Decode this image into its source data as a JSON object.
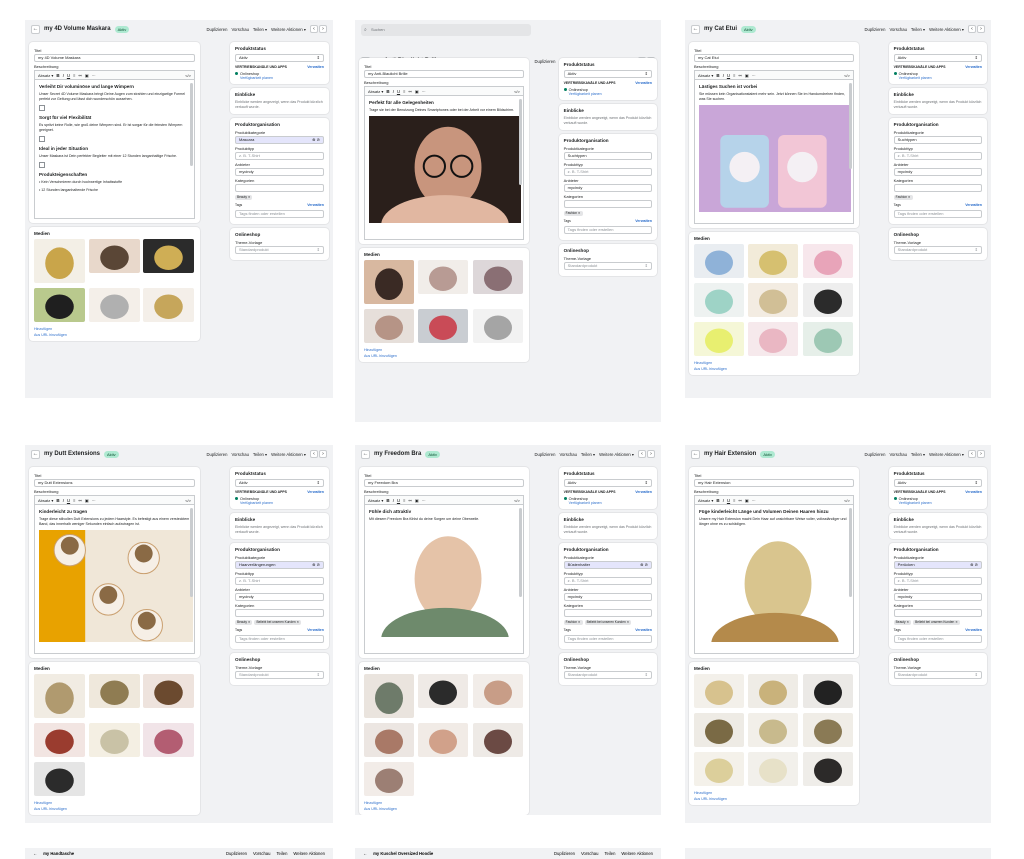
{
  "common": {
    "duplicate": "Duplizieren",
    "preview": "Vorschau",
    "share": "Teilen",
    "more_actions": "Weitere Aktionen",
    "title_label": "Titel",
    "description_label": "Beschreibung",
    "paragraph_select": "Absatz",
    "status_card": "Produktstatus",
    "status_value": "Aktiv",
    "channels_label": "VERTRIEBSKANÄLE UND APPS",
    "manage": "Verwalten",
    "online_store": "Onlineshop",
    "schedule": "Verfügbarkeit planen",
    "insights": "Einblicke",
    "insights_text": "Einblicke werden angezeigt, wenn das Produkt kürzlich verkauft wurde.",
    "org": "Produktorganisation",
    "category_label": "Produktkategorie",
    "type_label": "Produkttyp",
    "type_placeholder": "z. B. T-Shirt",
    "vendor_label": "Anbieter",
    "vendor_value": "mycindy",
    "collections_label": "Kategorien",
    "tags_label": "Tags",
    "tags_placeholder": "Tags finden oder erstellen",
    "online_store_card": "Onlineshop",
    "theme_label": "Theme-Vorlage",
    "theme_value": "Standardprodukt",
    "media": "Medien",
    "add": "Hinzufügen",
    "add_url": "Aus URL hinzufügen",
    "active_badge": "Aktiv",
    "search_placeholder": "Suchen"
  },
  "shots": [
    {
      "title": "my 4D Volume Maskara",
      "heading": "Verleiht Dir voluminöse und lange Wimpern",
      "paragraphs": [
        "Unser Secret 4D Volume Maskara bringt Deine Augen zum strahlen und einzigartige Formel perfekt zur Geltung und lässt dich wunderschön aussehen.",
        "Sorgt für viel Flexibilität",
        "Es spritzt keine Rolle, wie groß deine Wimpern sind. Er ist sorgar für die feinsten Wimpern geeignet.",
        "Ideal in jeder Situation",
        "Unser Maskara ist Dein perfekter Begleiter mit einer 12 Stunden langanhaltige Frische.",
        "Produkteigenschaften",
        "• Kein Verschmieren durch hochwertige Inhaltsstoffe",
        "• 12 Stunden langanhaltende Frische"
      ],
      "category": "Mascara",
      "collections": [
        "Beauty"
      ]
    },
    {
      "title": "my Anti-Blaulicht Brille",
      "heading": "Perfekt für alle Gelegenheiten",
      "paragraphs": [
        "Trage sie bei der Benutzung Deines Smartphones oder bei der Arbeit vor einem Bildschirm."
      ],
      "category": "Suchtypen",
      "collections": [
        "Fashion"
      ]
    },
    {
      "title": "my Cat Etui",
      "heading": "Lästiges Suchen ist vorbei",
      "paragraphs": [
        "Sie müssen kein Organisationstalent mehr sein. Jetzt können Sie im Handumdrehen finden, was Sie suchen."
      ],
      "category": "Suchtypen",
      "collections": [
        "Fashion"
      ]
    },
    {
      "title": "my Dutt Extensions",
      "heading": "Kinderleicht zu tragen",
      "paragraphs": [
        "Trage diese stilvollen Dutt Extensions zu jedem Haarstyle. Es befestigt aus einem verstecktem Band, das innerhalb weniger Sekunden einfach aufzutragen ist."
      ],
      "category": "Haarverlängerungen",
      "collections": [
        "Beauty",
        "Beliebt bei unseren Kunden"
      ]
    },
    {
      "title": "my Freedom Bra",
      "heading": "Fühle dich attraktiv",
      "paragraphs": [
        "Mit diesem Freedom Bra fühlst du deine Sorgen um deine Oberweile."
      ],
      "category": "Büstenhalter",
      "collections": [
        "Fashion",
        "Beliebt bei unseren Kunden"
      ]
    },
    {
      "title": "my Hair Extension",
      "heading": "Füge kinderleicht Länge und Volumen Deinen Haaren hinzu",
      "paragraphs": [
        "Unsere my Hair Extension macht Dein Haar auf unsichtbare Weise voller, volksständiger und länger ohne es zu schädigen."
      ],
      "category": "Perücken",
      "collections": [
        "Beauty",
        "Beliebt bei unseren Kunden"
      ]
    },
    {
      "title": "my Handtasche"
    },
    {
      "title": "my Kuschel Oversized Hoodie"
    }
  ],
  "colors": {
    "badge_bg": "#aee9d1",
    "link": "#2c6ecb",
    "category_highlight": "#e4e5fb"
  }
}
